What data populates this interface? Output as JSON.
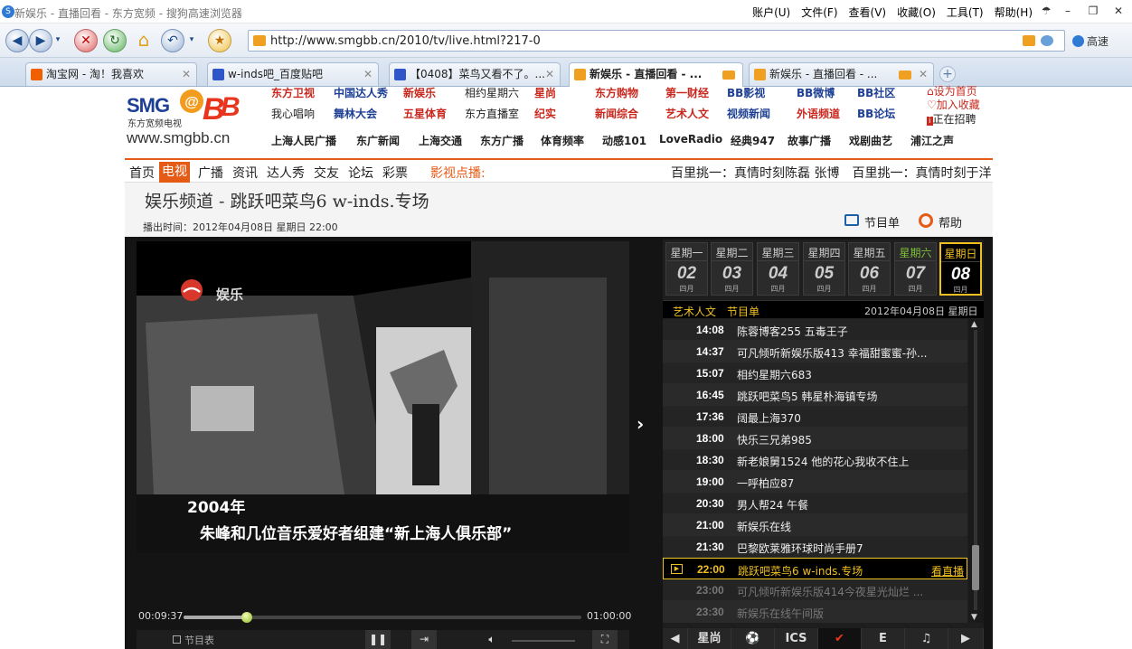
{
  "window": {
    "title": "新娱乐 - 直播回看 - 东方宽频 - 搜狗高速浏览器",
    "menu": [
      "账户(U)",
      "文件(F)",
      "查看(V)",
      "收藏(O)",
      "工具(T)",
      "帮助(H)"
    ]
  },
  "navbar": {
    "url": "http://www.smgbb.cn/2010/tv/live.html?217-0",
    "speed_label": "高速"
  },
  "tabs": [
    {
      "label": "淘宝网 - 淘！我喜欢",
      "active": false
    },
    {
      "label": "w-inds吧_百度贴吧",
      "active": false
    },
    {
      "label": "【0408】菜鸟又看不了。...",
      "active": false
    },
    {
      "label": "新娱乐 - 直播回看 - ...",
      "active": true
    },
    {
      "label": "新娱乐 - 直播回看 - ...",
      "active": false
    }
  ],
  "site": {
    "logo_text": "SMG",
    "logo_sub": "东方宽频电视",
    "logo_url": "www.smgbb.cn",
    "channels_row1": [
      "东方卫视",
      "中国达人秀",
      "新娱乐",
      "相约星期六",
      "星尚",
      "东方购物",
      "第一财经",
      "BB影视",
      "BB微博",
      "BB社区"
    ],
    "channels_row2": [
      "我心唱响",
      "舞林大会",
      "五星体育",
      "东方直播室",
      "纪实",
      "新闻综合",
      "艺术人文",
      "视频新闻",
      "外语频道",
      "BB论坛"
    ],
    "right_links": [
      "设为首页",
      "加入收藏",
      "正在招聘"
    ],
    "radio": [
      "上海人民广播",
      "东广新闻",
      "上海交通",
      "东方广播",
      "体育频率",
      "动感101",
      "LoveRadio",
      "经典947",
      "故事广播",
      "戏剧曲艺",
      "浦江之声"
    ]
  },
  "sitenav": {
    "items": [
      "首页",
      "电视",
      "广播",
      "资讯",
      "达人秀",
      "交友",
      "论坛",
      "彩票"
    ],
    "active_index": 1,
    "vod_label": "影视点播:",
    "marquee": "百里挑一：真情时刻陈磊 张博　百里挑一：真情时刻于洋"
  },
  "program": {
    "title": "娱乐频道 - 跳跃吧菜鸟6 w-inds.专场",
    "airtime": "播出时间：2012年04月08日 星期日 22:00",
    "schedule_btn": "节目单",
    "help_btn": "帮助"
  },
  "player": {
    "channel_logo_text": "娱乐",
    "subtitle_line1": "2004年",
    "subtitle_line2": "朱峰和几位音乐爱好者组建“新上海人俱乐部”",
    "time_current": "00:09:37",
    "time_total": "01:00:00",
    "progress": 0.16,
    "list_btn": "节目表"
  },
  "schedule": {
    "days": [
      {
        "name": "星期一",
        "date": "02",
        "month": "四月"
      },
      {
        "name": "星期二",
        "date": "03",
        "month": "四月"
      },
      {
        "name": "星期三",
        "date": "04",
        "month": "四月"
      },
      {
        "name": "星期四",
        "date": "05",
        "month": "四月"
      },
      {
        "name": "星期五",
        "date": "06",
        "month": "四月"
      },
      {
        "name": "星期六",
        "date": "07",
        "month": "四月"
      },
      {
        "name": "星期日",
        "date": "08",
        "month": "四月"
      }
    ],
    "active_day": 6,
    "channel": "艺术人文",
    "list_label": "节目单",
    "date_label": "2012年04月08日 星期日",
    "items": [
      {
        "time": "14:08",
        "name": "陈蓉博客255 五毒王子",
        "state": "past"
      },
      {
        "time": "14:37",
        "name": "可凡倾听新娱乐版413 幸福甜蜜蜜-孙...",
        "state": "past"
      },
      {
        "time": "15:07",
        "name": "相约星期六683",
        "state": "past"
      },
      {
        "time": "16:45",
        "name": "跳跃吧菜鸟5 韩星朴海镇专场",
        "state": "past"
      },
      {
        "time": "17:36",
        "name": "阔最上海370",
        "state": "past"
      },
      {
        "time": "18:00",
        "name": "快乐三兄弟985",
        "state": "past"
      },
      {
        "time": "18:30",
        "name": "新老娘舅1524 他的花心我收不住上",
        "state": "past"
      },
      {
        "time": "19:00",
        "name": "一呼柏应87",
        "state": "past"
      },
      {
        "time": "20:30",
        "name": "男人帮24 午餐",
        "state": "past"
      },
      {
        "time": "21:00",
        "name": "新娱乐在线",
        "state": "past"
      },
      {
        "time": "21:30",
        "name": "巴黎欧莱雅环球时尚手册7",
        "state": "past"
      },
      {
        "time": "22:00",
        "name": "跳跃吧菜鸟6 w-inds.专场",
        "state": "current",
        "live": "看直播"
      },
      {
        "time": "23:00",
        "name": "可凡倾听新娱乐版414今夜星光灿烂 ...",
        "state": "future"
      },
      {
        "time": "23:30",
        "name": "新娱乐在线午间版",
        "state": "future"
      }
    ],
    "categories": [
      "星尚",
      "⚽",
      "ICS",
      "✔",
      "E",
      "♫"
    ]
  }
}
